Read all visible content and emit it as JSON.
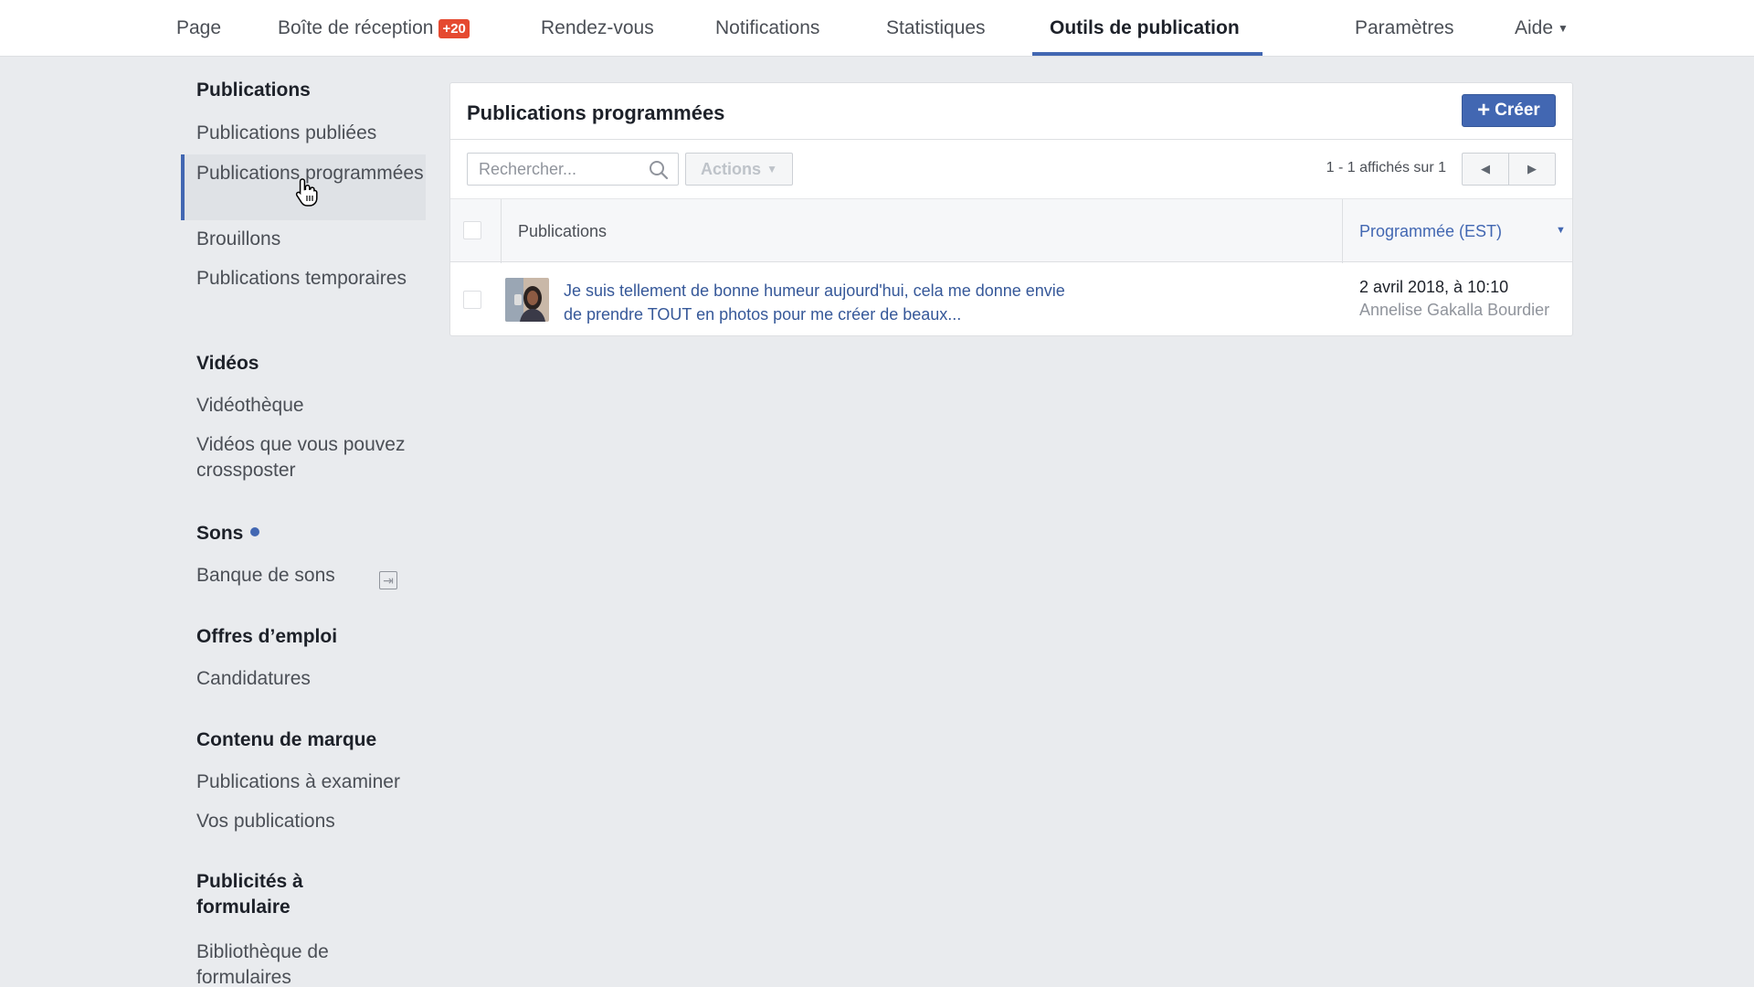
{
  "nav": {
    "items": [
      "Page",
      "Boîte de réception",
      "Rendez-vous",
      "Notifications",
      "Statistiques",
      "Outils de publication",
      "Paramètres",
      "Aide"
    ],
    "inbox_badge": "+20",
    "active": "Outils de publication"
  },
  "sidebar": {
    "sections": [
      {
        "heading": "Publications",
        "items": [
          "Publications publiées",
          "Publications programmées",
          "Brouillons",
          "Publications temporaires"
        ]
      },
      {
        "heading": "Vidéos",
        "items": [
          "Vidéothèque",
          "Vidéos que vous pouvez crossposter"
        ]
      },
      {
        "heading": "Sons",
        "items": [
          "Banque de sons"
        ]
      },
      {
        "heading": "Offres d’emploi",
        "items": [
          "Candidatures"
        ]
      },
      {
        "heading": "Contenu de marque",
        "items": [
          "Publications à examiner",
          "Vos publications"
        ]
      },
      {
        "heading": "Publicités à formulaire",
        "items": [
          "Bibliothèque de formulaires"
        ]
      }
    ],
    "active_item": "Publications programmées"
  },
  "panel": {
    "title": "Publications programmées",
    "create_label": "Créer",
    "search_placeholder": "Rechercher...",
    "actions_label": "Actions",
    "paging_text": "1 - 1 affichés sur 1",
    "columns": [
      "Publications",
      "Programmée (EST)"
    ],
    "rows": [
      {
        "text": "Je suis tellement de bonne humeur aujourd'hui, cela me donne envie de prendre TOUT en photos pour me créer de beaux...",
        "date": "2 avril 2018, à 10:10",
        "author": "Annelise Gakalla Bourdier"
      }
    ]
  },
  "colors": {
    "accent": "#4267b2",
    "link": "#365899",
    "badge": "#e54a31",
    "background": "#e9ebee"
  }
}
